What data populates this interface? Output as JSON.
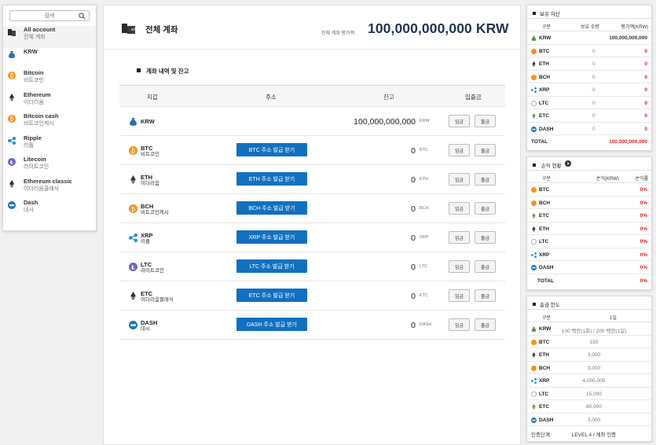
{
  "search": {
    "placeholder": "검색"
  },
  "sidebar": {
    "items": [
      {
        "name": "All account",
        "kr": "전체 계좌",
        "icon": "wallet-icon"
      },
      {
        "name": "KRW",
        "kr": "",
        "icon": "money-bag-icon"
      },
      {
        "name": "Bitcoin",
        "kr": "비트코인",
        "icon": "bitcoin-icon"
      },
      {
        "name": "Ethereum",
        "kr": "이더리움",
        "icon": "ethereum-icon"
      },
      {
        "name": "Bitcoin cash",
        "kr": "비트코인캐시",
        "icon": "bitcoin-cash-icon"
      },
      {
        "name": "Ripple",
        "kr": "리플",
        "icon": "ripple-icon"
      },
      {
        "name": "Litecoin",
        "kr": "라이트코인",
        "icon": "litecoin-icon"
      },
      {
        "name": "Ethereum classic",
        "kr": "이더리움클래식",
        "icon": "ethereum-classic-icon"
      },
      {
        "name": "Dash",
        "kr": "대시",
        "icon": "dash-icon"
      }
    ]
  },
  "main": {
    "title": "전체 계좌",
    "estimated_label": "전체 계좌 평가액",
    "estimated_value": "100,000,000,000 KRW",
    "section_title": "계좌 내역 및 잔고",
    "headers": {
      "wallet": "지갑",
      "address": "주소",
      "balance": "잔고",
      "transfer": "입출금"
    },
    "deposit_label": "입금",
    "withdraw_label": "출금",
    "rows": [
      {
        "name": "KRW",
        "kr": "",
        "address_btn": "",
        "balance": "100,000,000,000",
        "unit": "KRW"
      },
      {
        "name": "BTC",
        "kr": "비트코인",
        "address_btn": "BTC 주소 발급 받기",
        "balance": "0",
        "unit": "BTC"
      },
      {
        "name": "ETH",
        "kr": "이더리움",
        "address_btn": "ETH 주소 발급 받기",
        "balance": "0",
        "unit": "ETH"
      },
      {
        "name": "BCH",
        "kr": "비트코인캐시",
        "address_btn": "BCH 주소 발급 받기",
        "balance": "0",
        "unit": "BCH"
      },
      {
        "name": "XRP",
        "kr": "리플",
        "address_btn": "XRP 주소 발급 받기",
        "balance": "0",
        "unit": "XRP"
      },
      {
        "name": "LTC",
        "kr": "라이트코인",
        "address_btn": "LTC 주소 발급 받기",
        "balance": "0",
        "unit": "LTC"
      },
      {
        "name": "ETC",
        "kr": "이더리움클래식",
        "address_btn": "ETC 주소 발급 받기",
        "balance": "0",
        "unit": "ETC"
      },
      {
        "name": "DASH",
        "kr": "대시",
        "address_btn": "DASH 주소 발급 받기",
        "balance": "0",
        "unit": "DASH"
      }
    ]
  },
  "holdings": {
    "title": "보유 자산",
    "headers": {
      "c1": "구분",
      "c2": "보유 수량",
      "c3": "평가액(KRW)"
    },
    "rows": [
      {
        "name": "KRW",
        "qty": "",
        "value": "100,000,000,000"
      },
      {
        "name": "BTC",
        "qty": "0",
        "value": "0"
      },
      {
        "name": "ETH",
        "qty": "0",
        "value": "0"
      },
      {
        "name": "BCH",
        "qty": "0",
        "value": "0"
      },
      {
        "name": "XRP",
        "qty": "0",
        "value": "0"
      },
      {
        "name": "LTC",
        "qty": "0",
        "value": "0"
      },
      {
        "name": "ETC",
        "qty": "0",
        "value": "0"
      },
      {
        "name": "DASH",
        "qty": "0",
        "value": "0"
      }
    ],
    "total_label": "TOTAL",
    "total_value": "100,000,000,000"
  },
  "profit": {
    "title": "손익 현황",
    "headers": {
      "c1": "구분",
      "c2": "손익(KRW)",
      "c3": "손익률"
    },
    "rows": [
      {
        "name": "BTC",
        "pl": "",
        "rate": "0%"
      },
      {
        "name": "BCH",
        "pl": "",
        "rate": "0%"
      },
      {
        "name": "ETC",
        "pl": "",
        "rate": "0%"
      },
      {
        "name": "ETH",
        "pl": "",
        "rate": "0%"
      },
      {
        "name": "LTC",
        "pl": "",
        "rate": "0%"
      },
      {
        "name": "XRP",
        "pl": "",
        "rate": "0%"
      },
      {
        "name": "DASH",
        "pl": "",
        "rate": "0%"
      }
    ],
    "total_label": "TOTAL",
    "total_rate": "0%"
  },
  "limits": {
    "title": "출금 한도",
    "headers": {
      "c1": "구분",
      "c2": "1일"
    },
    "rows": [
      {
        "name": "KRW",
        "limit": "100 백만(1회) / 200 백만(1일)"
      },
      {
        "name": "BTC",
        "limit": "150"
      },
      {
        "name": "ETH",
        "limit": "3,000"
      },
      {
        "name": "BCH",
        "limit": "3,000"
      },
      {
        "name": "XRP",
        "limit": "4,000,000"
      },
      {
        "name": "LTC",
        "limit": "15,000"
      },
      {
        "name": "ETC",
        "limit": "80,000"
      },
      {
        "name": "DASH",
        "limit": "3,000"
      }
    ],
    "level_label": "인증단계",
    "level_value": "LEVEL 4 / 계좌 인증"
  },
  "colors": {
    "accent_blue": "#1171c0",
    "value_navy": "#1f3654",
    "loss_red": "#e02020",
    "btc_orange": "#f7931a"
  }
}
